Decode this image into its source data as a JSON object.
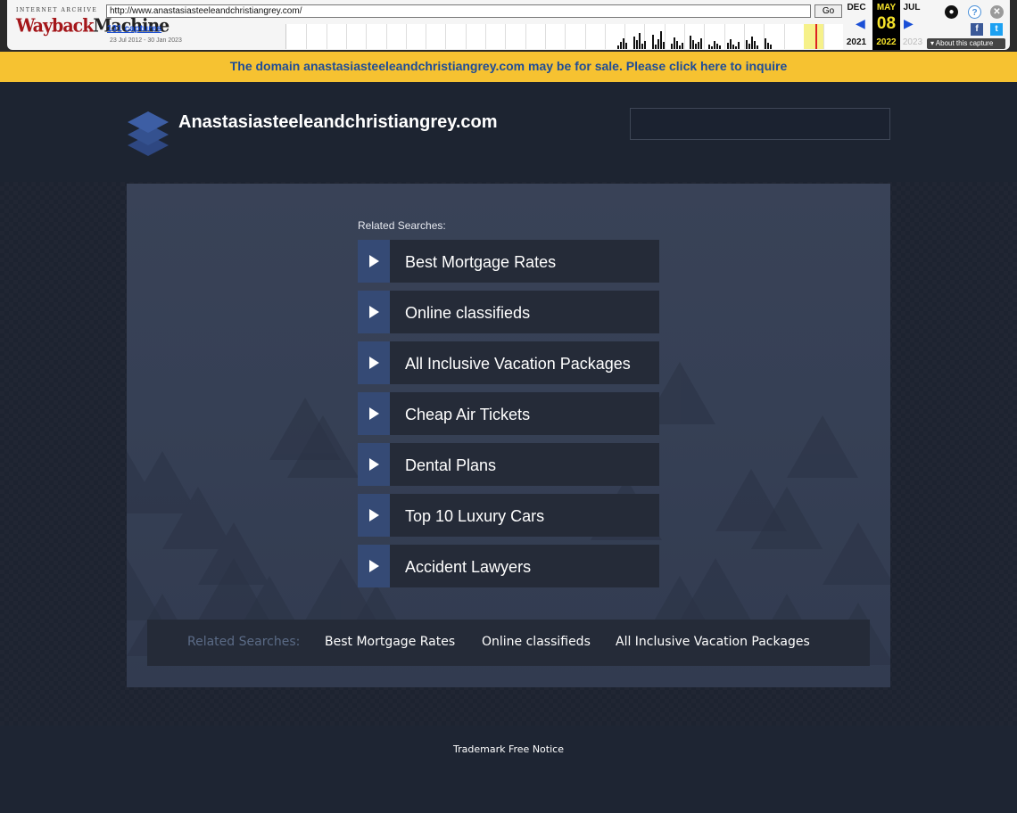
{
  "wayback": {
    "logo_top": "INTERNET ARCHIVE",
    "logo_main_a": "Wayback",
    "logo_main_b": "Machine",
    "url": "http://www.anastasiasteeleandchristiangrey.com/",
    "go_label": "Go",
    "captures": "131 captures",
    "range": "23 Jul 2012 - 30 Jan 2023",
    "prev_month": "DEC",
    "prev_year": "2021",
    "cur_month": "MAY",
    "cur_day": "08",
    "cur_year": "2022",
    "next_month": "JUL",
    "next_year": "2023",
    "about": "About this capture"
  },
  "banner": {
    "text": "The domain anastasiasteeleandchristiangrey.com may be for sale. Please click here to inquire"
  },
  "site": {
    "title": "Anastasiasteeleandchristiangrey.com"
  },
  "related": {
    "title": "Related Searches:",
    "items": [
      "Best Mortgage Rates",
      "Online classifieds",
      "All Inclusive Vacation Packages",
      "Cheap Air Tickets",
      "Dental Plans",
      "Top 10 Luxury Cars",
      "Accident Lawyers"
    ]
  },
  "bottom": {
    "title": "Related Searches:",
    "links": [
      "Best Mortgage Rates",
      "Online classifieds",
      "All Inclusive Vacation Packages"
    ]
  },
  "footer": {
    "link": "Trademark Free Notice"
  },
  "colors": {
    "banner_bg": "#f6c231",
    "banner_text": "#1e4c97",
    "accent_tab": "#354a75",
    "item_bg": "#252b38",
    "page_bg": "#1b2230"
  }
}
